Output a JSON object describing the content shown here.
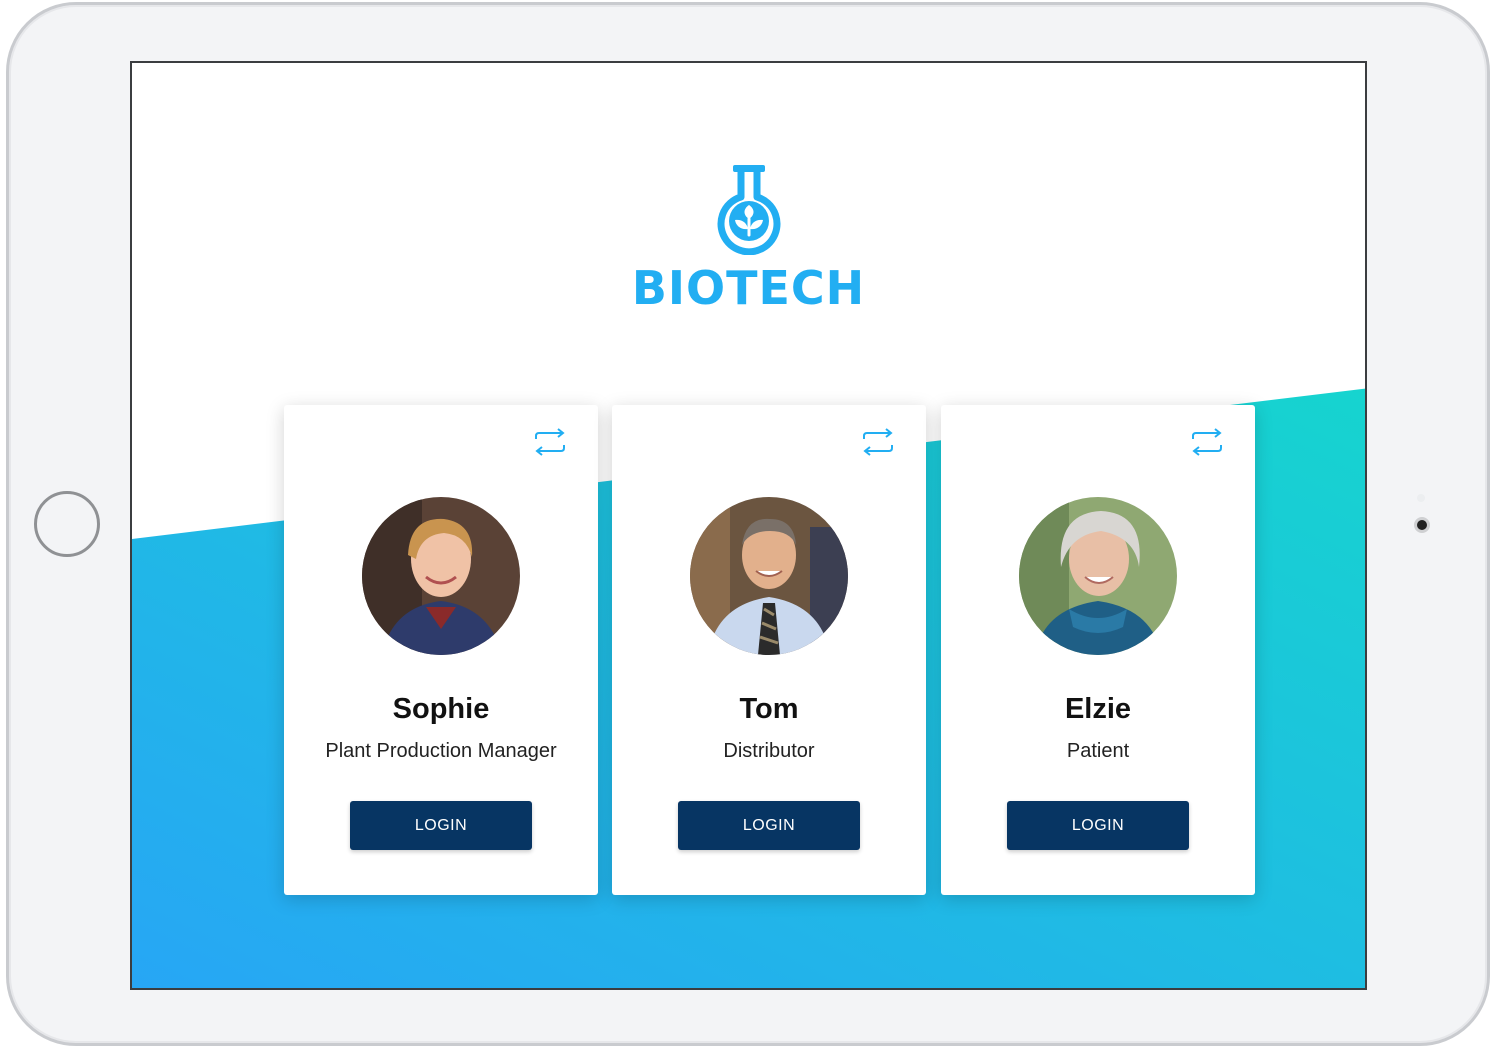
{
  "app": {
    "brand_name": "BIOTECH",
    "logo_icon": "flask-leaf-icon",
    "accent_color": "#22aef2",
    "gradient_colors": [
      "#27a6f5",
      "#16d4cf"
    ],
    "button_color": "#073563"
  },
  "device": {
    "home_button_icon": "home-button-ring",
    "camera_icon": "front-camera-dot"
  },
  "profiles": [
    {
      "name": "Sophie",
      "role": "Plant Production Manager",
      "login_label": "LOGIN",
      "switch_icon": "swap-arrows-icon",
      "avatar": "avatar-sophie"
    },
    {
      "name": "Tom",
      "role": "Distributor",
      "login_label": "LOGIN",
      "switch_icon": "swap-arrows-icon",
      "avatar": "avatar-tom"
    },
    {
      "name": "Elzie",
      "role": "Patient",
      "login_label": "LOGIN",
      "switch_icon": "swap-arrows-icon",
      "avatar": "avatar-elzie"
    }
  ]
}
